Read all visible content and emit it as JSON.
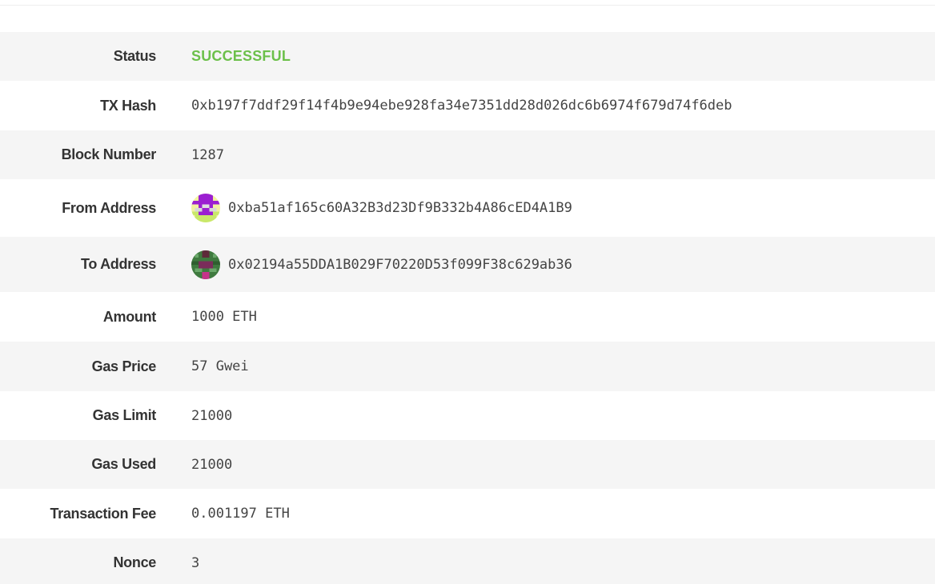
{
  "status_color": "#6cc04a",
  "rows": [
    {
      "label": "Status",
      "value": "SUCCESSFUL"
    },
    {
      "label": "TX Hash",
      "value": "0xb197f7ddf29f14f4b9e94ebe928fa34e7351dd28d026dc6b6974f679d74f6deb"
    },
    {
      "label": "Block Number",
      "value": "1287"
    },
    {
      "label": "From Address",
      "value": "0xba51af165c60A32B3d23Df9B332b4A86cED4A1B9",
      "icon": "identicon-from-icon"
    },
    {
      "label": "To Address",
      "value": "0x02194a55DDA1B029F70220D53f099F38c629ab36",
      "icon": "identicon-to-icon"
    },
    {
      "label": "Amount",
      "value": "1000 ETH"
    },
    {
      "label": "Gas Price",
      "value": "57 Gwei"
    },
    {
      "label": "Gas Limit",
      "value": "21000"
    },
    {
      "label": "Gas Used",
      "value": "21000"
    },
    {
      "label": "Transaction Fee",
      "value": "0.001197 ETH"
    },
    {
      "label": "Nonce",
      "value": "3"
    }
  ]
}
